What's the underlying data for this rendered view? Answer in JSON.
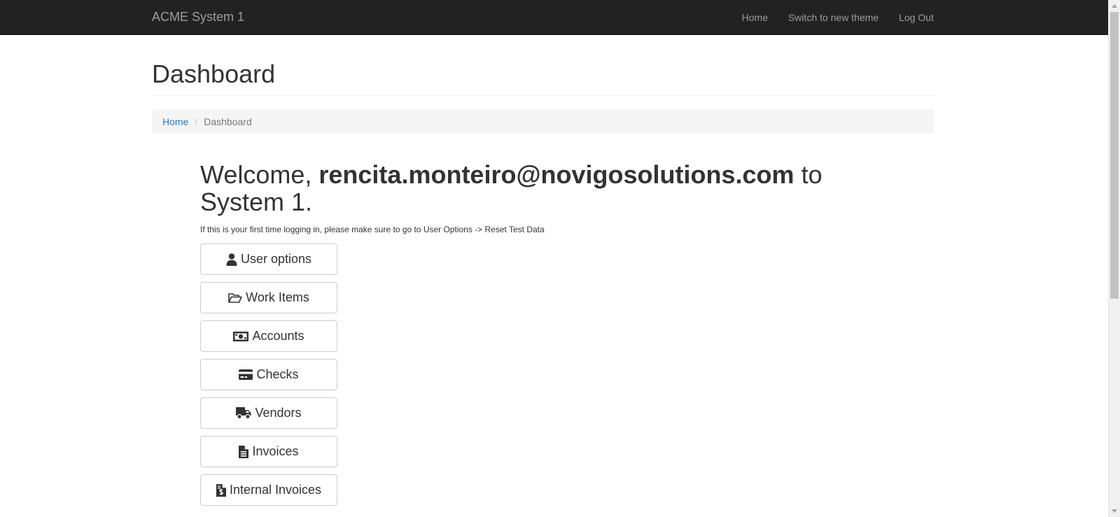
{
  "navbar": {
    "brand": "ACME System 1",
    "links": [
      "Home",
      "Switch to new theme",
      "Log Out"
    ]
  },
  "page_title": "Dashboard",
  "breadcrumb": {
    "home": "Home",
    "separator": "/",
    "current": "Dashboard"
  },
  "welcome": {
    "prefix": "Welcome, ",
    "email": "rencita.monteiro@novigosolutions.com",
    "suffix": " to System 1."
  },
  "hint": "If this is your first time logging in, please make sure to go to User Options -> Reset Test Data",
  "menu": [
    {
      "label": "User options",
      "icon": "user-icon"
    },
    {
      "label": "Work Items",
      "icon": "folder-open-icon"
    },
    {
      "label": "Accounts",
      "icon": "money-icon"
    },
    {
      "label": "Checks",
      "icon": "credit-card-icon"
    },
    {
      "label": "Vendors",
      "icon": "truck-icon"
    },
    {
      "label": "Invoices",
      "icon": "file-text-icon"
    },
    {
      "label": "Internal Invoices",
      "icon": "file-invoice-dollar-icon"
    }
  ],
  "colors": {
    "navbar_bg": "#222222",
    "navbar_text": "#9d9d9d",
    "link": "#337ab7",
    "breadcrumb_bg": "#f5f5f5"
  }
}
